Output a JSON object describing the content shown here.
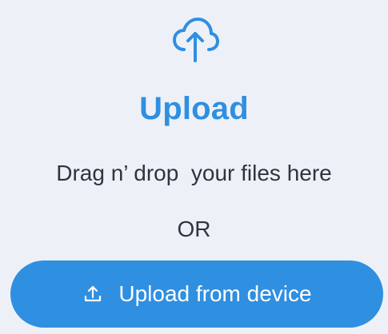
{
  "upload_panel": {
    "icon": "cloud-upload-icon",
    "title": "Upload",
    "instruction": "Drag n’ drop  your files here",
    "separator": "OR",
    "button": {
      "icon": "upload-icon",
      "label": "Upload from device"
    }
  },
  "colors": {
    "background": "#edf1f7",
    "accent": "#2f8fe1",
    "text": "#2e3440",
    "button_text": "#ffffff"
  }
}
